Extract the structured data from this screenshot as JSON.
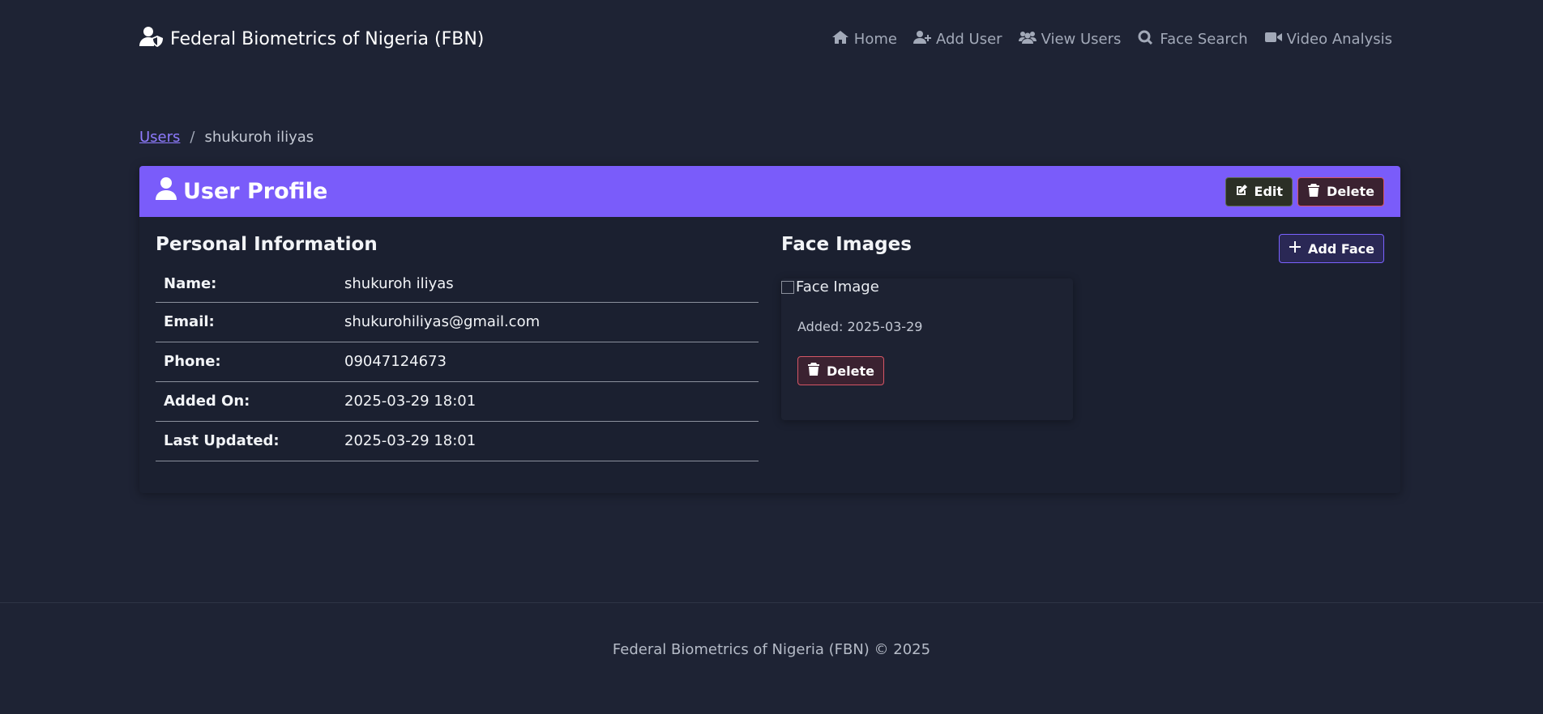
{
  "navbar": {
    "brand": "Federal Biometrics of Nigeria (FBN)",
    "links": [
      {
        "label": "Home",
        "icon": "home-icon"
      },
      {
        "label": "Add User",
        "icon": "user-plus-icon"
      },
      {
        "label": "View Users",
        "icon": "users-icon"
      },
      {
        "label": "Face Search",
        "icon": "search-icon"
      },
      {
        "label": "Video Analysis",
        "icon": "video-icon"
      }
    ]
  },
  "breadcrumb": {
    "parent": "Users",
    "separator": "/",
    "current": "shukuroh iliyas"
  },
  "profile": {
    "title": "User Profile",
    "edit_label": "Edit",
    "delete_label": "Delete",
    "personal_title": "Personal Information",
    "rows": [
      {
        "label": "Name:",
        "value": "shukuroh iliyas"
      },
      {
        "label": "Email:",
        "value": "shukurohiliyas@gmail.com"
      },
      {
        "label": "Phone:",
        "value": "09047124673"
      },
      {
        "label": "Added On:",
        "value": "2025-03-29 18:01"
      },
      {
        "label": "Last Updated:",
        "value": "2025-03-29 18:01"
      }
    ]
  },
  "faces": {
    "title": "Face Images",
    "add_label": "Add Face",
    "image_alt": "Face Image",
    "added": "Added: 2025-03-29",
    "delete_label": "Delete"
  },
  "footer": {
    "text": "Federal Biometrics of Nigeria (FBN) © 2025"
  },
  "colors": {
    "accent": "#7a5cfa",
    "background": "#1e2334",
    "danger": "#d55665"
  }
}
